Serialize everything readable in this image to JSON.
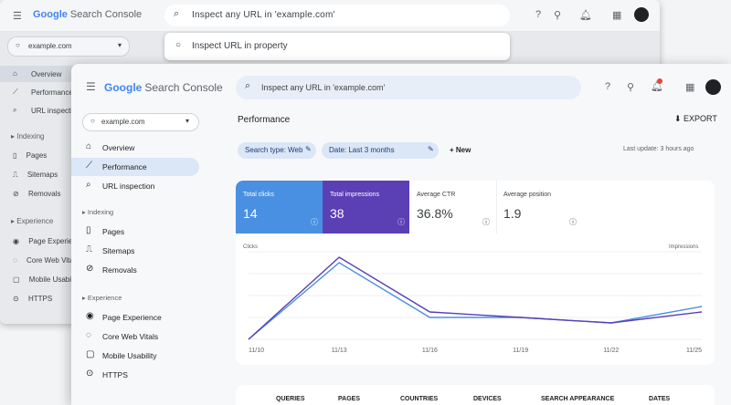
{
  "brand": {
    "logo": "Google",
    "title": "Search Console"
  },
  "back_window": {
    "search_value": "Inspect any URL in 'example.com'",
    "dropdown_item": "Inspect URL in property",
    "property": "example.com",
    "nav": [
      "Overview",
      "Performance",
      "URL inspection"
    ],
    "sections": [
      "Indexing",
      "Experience"
    ],
    "nav2": [
      "Pages",
      "Sitemaps",
      "Removals"
    ],
    "nav3": [
      "Page Experience",
      "Core Web Vitals",
      "Mobile Usability",
      "HTTPS"
    ]
  },
  "front_window": {
    "search_placeholder": "Inspect any URL in 'example.com'",
    "property": "example.com",
    "nav_top": [
      "Overview",
      "Performance",
      "URL inspection"
    ],
    "section_indexing": "Indexing",
    "nav_indexing": [
      "Pages",
      "Sitemaps",
      "Removals"
    ],
    "section_experience": "Experience",
    "nav_experience": [
      "Page Experience",
      "Core Web Vitals",
      "Mobile Usability",
      "HTTPS"
    ],
    "page_title": "Performance",
    "export_label": "EXPORT",
    "chips": [
      "Search type: Web",
      "Date: Last 3 months"
    ],
    "new_label": "+ New",
    "last_update": "Last update: 3 hours ago",
    "metrics": [
      {
        "label": "Total clicks",
        "value": "14"
      },
      {
        "label": "Total impressions",
        "value": "38"
      },
      {
        "label": "Average CTR",
        "value": "36.8%"
      },
      {
        "label": "Average position",
        "value": "1.9"
      }
    ],
    "chart_left_label": "Clicks",
    "chart_right_label": "Impressions",
    "table_headers": [
      "QUERIES",
      "PAGES",
      "COUNTRIES",
      "DEVICES",
      "SEARCH APPEARANCE",
      "DATES"
    ]
  },
  "chart_data": {
    "type": "line",
    "x": [
      "11/10",
      "11/13",
      "11/16",
      "11/19",
      "11/22",
      "11/25"
    ],
    "series": [
      {
        "name": "Clicks",
        "values": [
          0,
          14,
          4,
          4,
          3,
          6
        ]
      },
      {
        "name": "Impressions",
        "values": [
          0,
          15,
          5,
          4,
          3,
          5
        ]
      }
    ],
    "colors": {
      "clicks": "#4a90e2",
      "impressions": "#5b3fb5"
    }
  }
}
